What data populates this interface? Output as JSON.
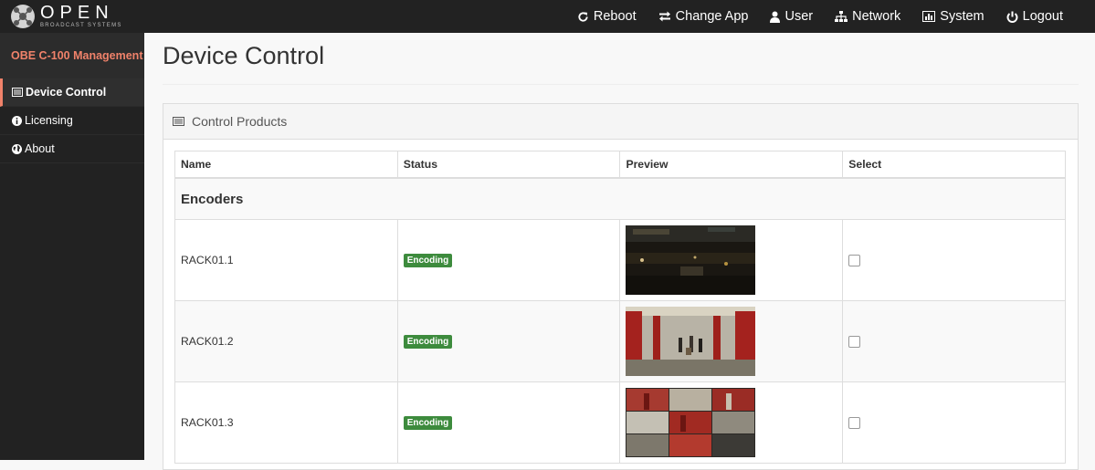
{
  "brand": {
    "name": "OPEN",
    "tagline": "BROADCAST SYSTEMS"
  },
  "nav": [
    {
      "label": "Reboot",
      "icon": "refresh-icon"
    },
    {
      "label": "Change App",
      "icon": "exchange-icon"
    },
    {
      "label": "User",
      "icon": "user-icon"
    },
    {
      "label": "Network",
      "icon": "sitemap-icon"
    },
    {
      "label": "System",
      "icon": "bar-chart-icon"
    },
    {
      "label": "Logout",
      "icon": "power-icon"
    }
  ],
  "sidebar": {
    "header": "OBE C-100 Management",
    "items": [
      {
        "label": "Device Control",
        "icon": "list-alt-icon",
        "active": true
      },
      {
        "label": "Licensing",
        "icon": "info-circle-icon"
      },
      {
        "label": "About",
        "icon": "globe-icon"
      }
    ]
  },
  "page": {
    "title": "Device Control"
  },
  "panel": {
    "title": "Control Products",
    "columns": [
      "Name",
      "Status",
      "Preview",
      "Select"
    ],
    "group": "Encoders",
    "rows": [
      {
        "name": "RACK01.1",
        "status": "Encoding",
        "preview": "dark-street-scene",
        "selected": false
      },
      {
        "name": "RACK01.2",
        "status": "Encoding",
        "preview": "subway-platform",
        "selected": false
      },
      {
        "name": "RACK01.3",
        "status": "Encoding",
        "preview": "multiview-grid",
        "selected": false
      }
    ]
  },
  "colors": {
    "accent": "#f0826a",
    "status_ok": "#3d8b3d",
    "navbar": "#222222"
  }
}
